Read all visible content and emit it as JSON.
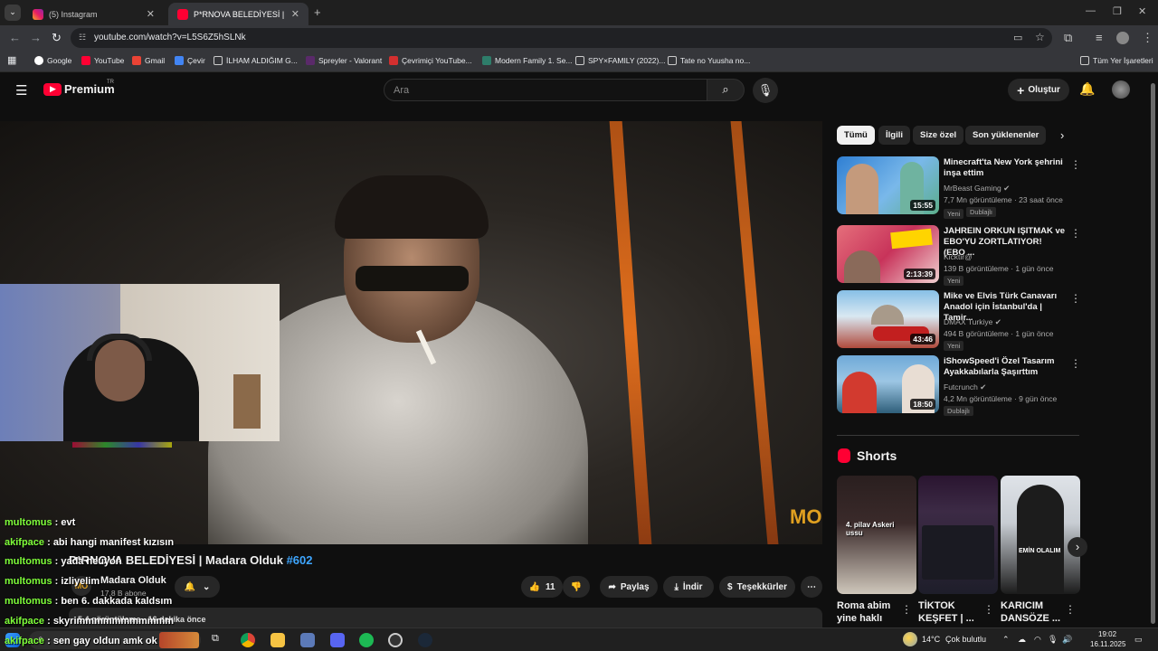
{
  "browser": {
    "tabs": [
      {
        "title": "(5) Instagram",
        "active": false
      },
      {
        "title": "P*RNOVA BELEDİYESİ | Madara Olduk",
        "active": true
      }
    ],
    "url": "youtube.com/watch?v=L5S6Z5hSLNk",
    "bookmarks": [
      "Google",
      "YouTube",
      "Gmail",
      "Çevir",
      "İLHAM ALDIĞIM G...",
      "Spreyler - Valorant",
      "Çevrimiçi YouTube...",
      "Modern Family 1. Se...",
      "SPY×FAMILY (2022)...",
      "Tate no Yuusha no..."
    ],
    "all_bookmarks": "Tüm Yer İşaretleri"
  },
  "yt": {
    "logo": "Premium",
    "logo_region": "TR",
    "search_placeholder": "Ara",
    "create_label": "Oluştur"
  },
  "video": {
    "title_prefix": "P*RNOVA BELEDİYESİ | Madara Olduk ",
    "title_tag": "#602",
    "channel": "Madara Olduk",
    "subscribers": "17,8 B abone",
    "views_partial": "5,4 görüntüleme · 16 dakika önce",
    "likes": "11",
    "share": "Paylaş",
    "download": "İndir",
    "thanks": "Teşekkürler",
    "watermark": "MO"
  },
  "chat": [
    {
      "user": "multomus",
      "msg": "evt"
    },
    {
      "user": "akifpace",
      "msg": "abi hangi manifest kızısın"
    },
    {
      "user": "multomus",
      "msg": "yada neuyon"
    },
    {
      "user": "multomus",
      "msg": "izliyelim"
    },
    {
      "user": "multomus",
      "msg": "ben 6. dakkada kaldsım"
    },
    {
      "user": "akifpace",
      "msg": "skyrimmmmmmmmmmm"
    },
    {
      "user": "akifpace",
      "msg": "sen gay oldun amk ok"
    }
  ],
  "chips": [
    "Tümü",
    "İlgili",
    "Size özel",
    "Son yüklenenler"
  ],
  "related": [
    {
      "title": "Minecraft'ta New York şehrini inşa ettim",
      "channel": "MrBeast Gaming",
      "meta": "7,7 Mn görüntüleme · 23 saat önce",
      "duration": "15:55",
      "badges": [
        "Yeni",
        "Dublajlı"
      ]
    },
    {
      "title": "JAHREIN ORKUN IŞITMAK ve EBO'YU ZORTLATIYOR! (EBO ...",
      "channel": "Kicktir@",
      "meta": "139 B görüntüleme · 1 gün önce",
      "duration": "2:13:39",
      "badges": [
        "Yeni"
      ]
    },
    {
      "title": "Mike ve Elvis Türk Canavarı Anadol için İstanbul'da | Tamir...",
      "channel": "DMAX Turkiye",
      "meta": "494 B görüntüleme · 1 gün önce",
      "duration": "43:46",
      "badges": [
        "Yeni"
      ]
    },
    {
      "title": "iShowSpeed'i Özel Tasarım Ayakkabılarla Şaşırttım",
      "channel": "Futcrunch",
      "meta": "4,2 Mn görüntüleme · 9 gün önce",
      "duration": "18:50",
      "badges": [
        "Dublajlı"
      ]
    }
  ],
  "shorts": {
    "heading": "Shorts",
    "items": [
      {
        "title": "Roma abim yine haklı",
        "overlay": "4. pilav Askeri ussu"
      },
      {
        "title": "TİKTOK KEŞFET | ...",
        "overlay": ""
      },
      {
        "title": "KARICIM DANSÖZE ...",
        "overlay": "EMİN OLALIM"
      }
    ]
  },
  "taskbar": {
    "weather": "14°C",
    "weather_desc": "Çok bulutlu",
    "time": "19:02",
    "date": "16.11.2025"
  },
  "colors": {
    "accent_red": "#ff0033",
    "link_blue": "#3ea6ff",
    "chat_user": "#7fff3a"
  }
}
